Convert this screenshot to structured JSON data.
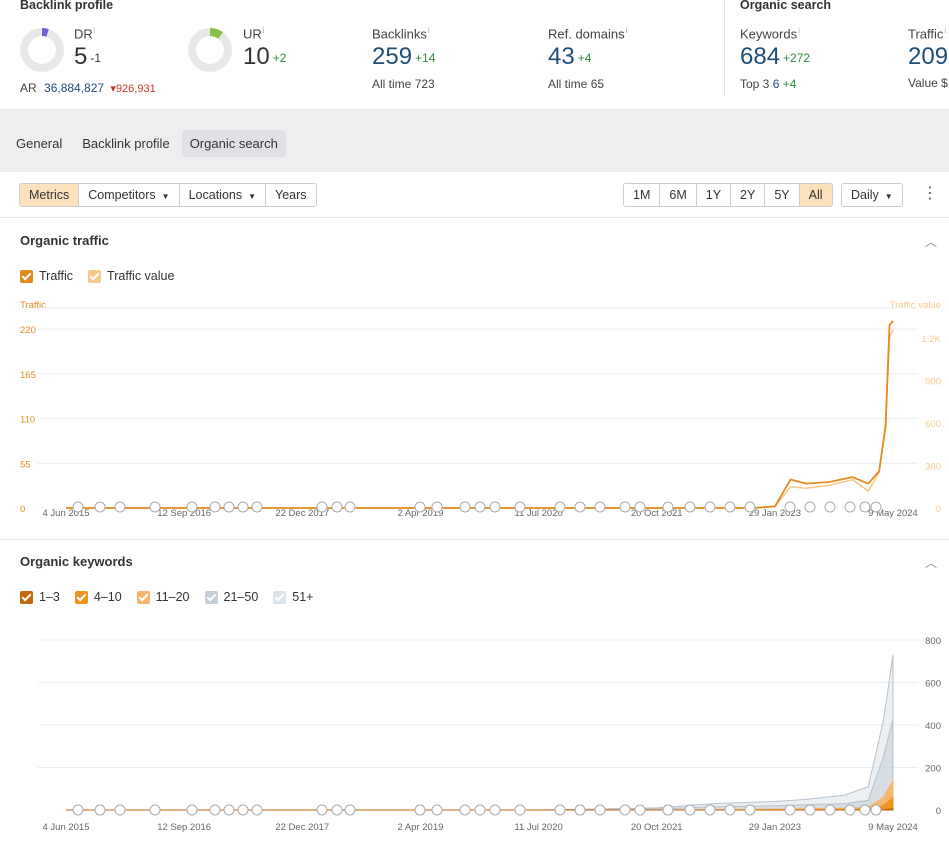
{
  "backlink_profile": {
    "title": "Backlink profile",
    "dr": {
      "label": "DR",
      "value": "5",
      "delta": "-1",
      "fill_fraction": 0.05
    },
    "ar": {
      "label": "AR",
      "value": "36,884,827",
      "delta": "▾926,931"
    },
    "ur": {
      "label": "UR",
      "value": "10",
      "delta": "+2",
      "fill_fraction": 0.1
    },
    "backlinks": {
      "label": "Backlinks",
      "value": "259",
      "delta": "+14",
      "sub_label": "All time",
      "sub_value": "723"
    },
    "ref_domains": {
      "label": "Ref. domains",
      "value": "43",
      "delta": "+4",
      "sub_label": "All time",
      "sub_value": "65"
    }
  },
  "organic_search": {
    "title": "Organic search",
    "keywords": {
      "label": "Keywords",
      "value": "684",
      "delta": "+272",
      "sub_label": "Top 3",
      "sub_value": "6",
      "sub_delta": "+4"
    },
    "traffic": {
      "label": "Traffic",
      "value": "209",
      "sub_label": "Value",
      "sub_value": "$"
    }
  },
  "tabs": [
    "General",
    "Backlink profile",
    "Organic search"
  ],
  "active_tab": 2,
  "toolbar": {
    "left": [
      "Metrics",
      "Competitors",
      "Locations",
      "Years"
    ],
    "ranges": [
      "1M",
      "6M",
      "1Y",
      "2Y",
      "5Y",
      "All"
    ],
    "interval": "Daily"
  },
  "colors": {
    "traffic": "#e58a1f",
    "traffic_value": "#f6c98a",
    "blue": "#1f4e7a",
    "k1": "#c3670a",
    "k2": "#f0931f",
    "k3": "#f6b56a",
    "k4": "#c5cdd6",
    "k5": "#dde3ea"
  },
  "x_dates": [
    "4 Jun 2015",
    "12 Sep 2016",
    "22 Dec 2017",
    "2 Apr 2019",
    "11 Jul 2020",
    "20 Oct 2021",
    "29 Jan 2023",
    "9 May 2024"
  ],
  "organic_traffic": {
    "title": "Organic traffic",
    "legend": [
      "Traffic",
      "Traffic value"
    ],
    "left_axis_title": "Traffic",
    "right_axis_title": "Traffic value",
    "left_ticks": [
      "0",
      "55",
      "110",
      "165",
      "220"
    ],
    "right_ticks": [
      "0",
      "300",
      "600",
      "900",
      "1.2K"
    ]
  },
  "organic_keywords": {
    "title": "Organic keywords",
    "legend": [
      "1–3",
      "4–10",
      "11–20",
      "21–50",
      "51+"
    ],
    "right_ticks": [
      "0",
      "200",
      "400",
      "600",
      "800"
    ]
  },
  "chart_data": [
    {
      "type": "line",
      "title": "Organic traffic",
      "x": [
        "2015-06-04",
        "2016-09-12",
        "2017-12-22",
        "2019-04-02",
        "2020-07-11",
        "2021-10-20",
        "2022-05-01",
        "2022-11-01",
        "2023-01-29",
        "2023-04-01",
        "2023-06-01",
        "2023-09-01",
        "2023-12-01",
        "2024-02-01",
        "2024-03-15",
        "2024-04-10",
        "2024-04-25",
        "2024-05-09"
      ],
      "series": [
        {
          "name": "Traffic",
          "axis": "left",
          "values": [
            0,
            0,
            0,
            0,
            0,
            0,
            0,
            0,
            2,
            35,
            30,
            32,
            38,
            30,
            45,
            100,
            225,
            230
          ]
        },
        {
          "name": "Traffic value",
          "axis": "right",
          "values": [
            0,
            0,
            0,
            0,
            0,
            0,
            0,
            0,
            10,
            150,
            140,
            160,
            200,
            120,
            250,
            600,
            1200,
            1260
          ]
        }
      ],
      "ylim_left": [
        0,
        230
      ],
      "ylim_right": [
        0,
        1320
      ]
    },
    {
      "type": "area",
      "title": "Organic keywords",
      "x": [
        "2015-06-04",
        "2016-09-12",
        "2017-12-22",
        "2019-04-02",
        "2020-07-11",
        "2021-10-20",
        "2022-06-01",
        "2023-01-29",
        "2023-06-01",
        "2023-11-01",
        "2024-02-01",
        "2024-04-01",
        "2024-05-09"
      ],
      "series": [
        {
          "name": "1–3",
          "values": [
            0,
            0,
            0,
            0,
            0,
            0,
            0,
            0,
            0,
            0,
            0,
            1,
            6
          ]
        },
        {
          "name": "4–10",
          "values": [
            0,
            0,
            0,
            0,
            0,
            0,
            0,
            0,
            2,
            3,
            5,
            20,
            60
          ]
        },
        {
          "name": "11–20",
          "values": [
            0,
            0,
            0,
            0,
            0,
            0,
            2,
            4,
            6,
            8,
            12,
            60,
            140
          ]
        },
        {
          "name": "21–50",
          "values": [
            0,
            0,
            0,
            0,
            0,
            5,
            15,
            20,
            25,
            30,
            45,
            250,
            430
          ]
        },
        {
          "name": "51+",
          "values": [
            0,
            0,
            0,
            0,
            0,
            10,
            30,
            40,
            50,
            70,
            110,
            420,
            730
          ]
        }
      ],
      "ylim": [
        0,
        800
      ]
    }
  ]
}
